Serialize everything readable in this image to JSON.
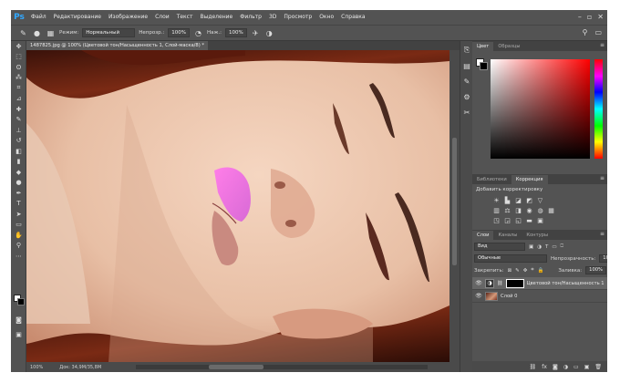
{
  "app": {
    "logo": "Ps"
  },
  "menu": [
    "Файл",
    "Редактирование",
    "Изображение",
    "Слои",
    "Текст",
    "Выделение",
    "Фильтр",
    "3D",
    "Просмотр",
    "Окно",
    "Справка"
  ],
  "options_bar": {
    "mode_label": "Режим:",
    "mode_value": "Нормальный",
    "opacity_label": "Непрозр.:",
    "opacity_value": "100%",
    "pressure_label": "Наж.:",
    "pressure_value": "100%"
  },
  "document": {
    "tab_title": "1487825.jpg @ 100% (Цветовой тон/Насыщенность 1, Слой-маска/8) *",
    "zoom": "100%",
    "doc_size": "Док: 34,9M/35,8M"
  },
  "color_panel": {
    "tabs": [
      "Цвет",
      "Образцы"
    ]
  },
  "adjustments_panel": {
    "tabs": [
      "Библиотеки",
      "Коррекция"
    ],
    "title": "Добавить корректировку"
  },
  "layers_panel": {
    "tabs": [
      "Слои",
      "Каналы",
      "Контуры"
    ],
    "filter_value": "Вид",
    "blend_mode": "Обычные",
    "opacity_label": "Непрозрачность:",
    "opacity_value": "100%",
    "lock_label": "Закрепить:",
    "fill_label": "Заливка:",
    "fill_value": "100%",
    "layers": [
      {
        "name": "Цветовой тон/Насыщенность 1",
        "selected": true
      },
      {
        "name": "Слой 0",
        "selected": false
      }
    ]
  },
  "colors": {
    "accent": "#31a8ff",
    "ui_bg": "#535353",
    "foreground": "#ffffff",
    "background": "#000000"
  }
}
